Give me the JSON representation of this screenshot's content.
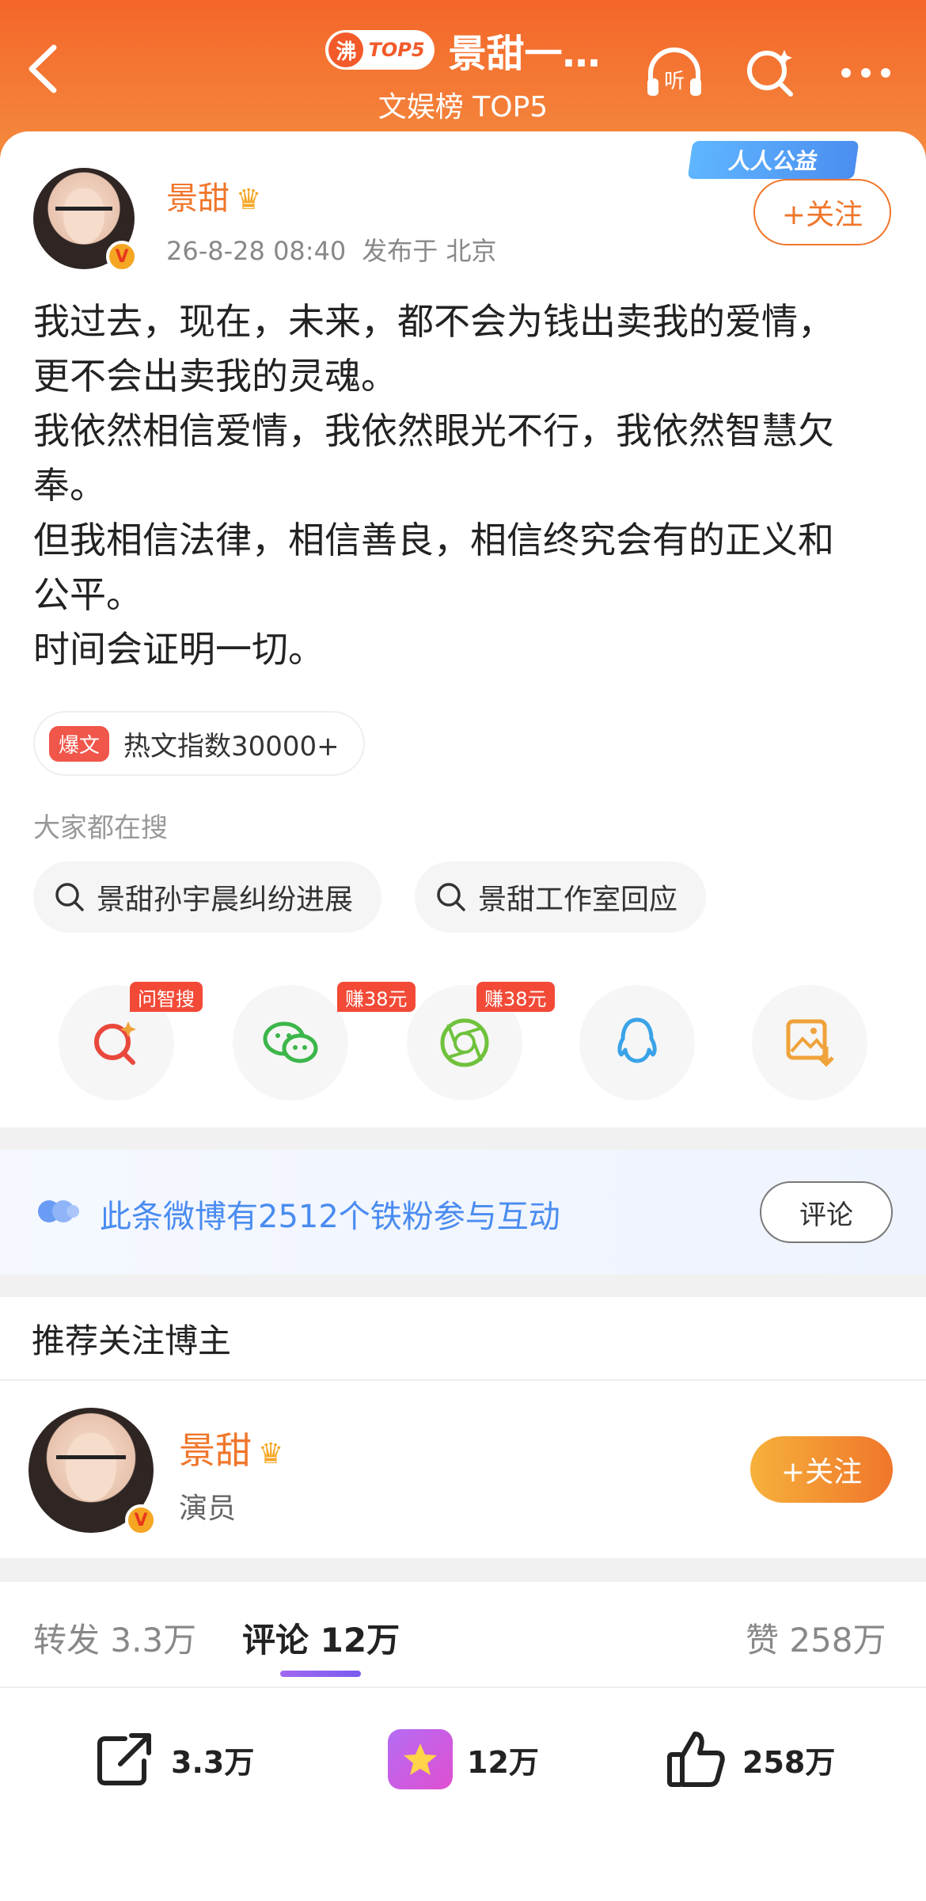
{
  "header": {
    "badge_fire": "沸",
    "badge_top": "TOP5",
    "title": "景甜一…",
    "subtitle": "文娱榜 TOP5",
    "listen_label": "听"
  },
  "post": {
    "author": "景甜",
    "time": "26-8-28 08:40",
    "location": "发布于 北京",
    "charity_badge": "人人公益",
    "follow_label": "+关注",
    "text": "我过去，现在，未来，都不会为钱出卖我的爱情，\n更不会出卖我的灵魂。\n我依然相信爱情，我依然眼光不行，我依然智慧欠\n奉。\n但我相信法律，相信善良，相信终究会有的正义和\n公平。\n时间会证明一切。",
    "hot_tag": "爆文",
    "hot_text": "热文指数30000+"
  },
  "search": {
    "label": "大家都在搜",
    "chips": [
      "景甜孙宇晨纠纷进展",
      "景甜工作室回应"
    ]
  },
  "share": {
    "items": [
      {
        "icon": "zhisou-icon",
        "tag": "问智搜"
      },
      {
        "icon": "wechat-icon",
        "tag": "赚38元"
      },
      {
        "icon": "moments-icon",
        "tag": "赚38元"
      },
      {
        "icon": "qq-icon",
        "tag": ""
      },
      {
        "icon": "save-image-icon",
        "tag": ""
      }
    ]
  },
  "fans": {
    "text": "此条微博有2512个铁粉参与互动",
    "button": "评论"
  },
  "recommend": {
    "title": "推荐关注博主",
    "name": "景甜",
    "role": "演员",
    "follow_label": "+关注"
  },
  "tabs": {
    "repost": "转发 3.3万",
    "comment": "评论 12万",
    "like": "赞 258万"
  },
  "bottom_bar": {
    "repost": "3.3万",
    "comment": "12万",
    "like": "258万"
  },
  "colors": {
    "header": "#f4662a",
    "accent": "#f0762b",
    "link_blue": "#4a8cf0",
    "tab_purple": "#7a5cf0"
  }
}
